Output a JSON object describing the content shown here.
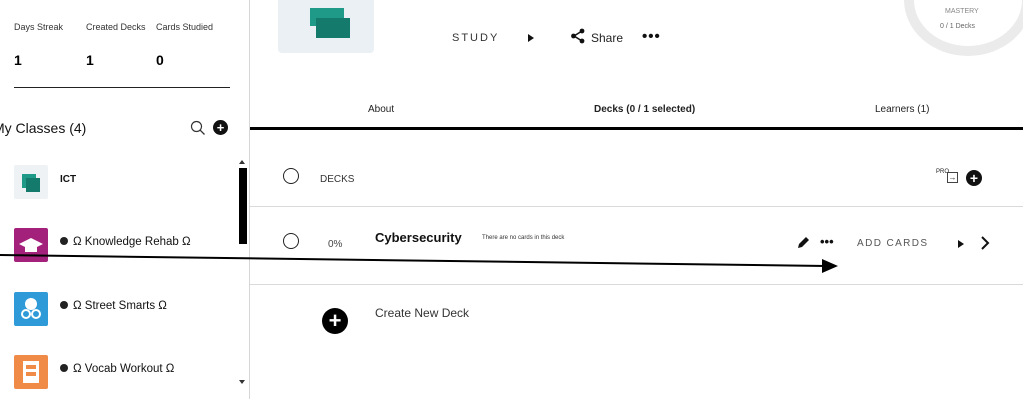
{
  "sidebar": {
    "stats": [
      {
        "label": "Days Streak",
        "value": "1"
      },
      {
        "label": "Created Decks",
        "value": "1"
      },
      {
        "label": "Cards Studied",
        "value": "0"
      }
    ],
    "classes_title": "My Classes (4)",
    "classes": [
      {
        "name": "ICT",
        "thumb_color": "#1f9a89",
        "icon": "stacked-squares-icon"
      },
      {
        "name": "Ω Knowledge Rehab Ω",
        "thumb_color": "#a3217a",
        "icon": "graduation-cap-icon"
      },
      {
        "name": "Ω Street Smarts Ω",
        "thumb_color": "#2e9bd8",
        "icon": "brain-glasses-icon"
      },
      {
        "name": "Ω Vocab Workout Ω",
        "thumb_color": "#f08a47",
        "icon": "dictionary-icon"
      }
    ]
  },
  "header": {
    "study_label": "STUDY",
    "share_label": "Share",
    "mastery_label": "MASTERY",
    "decks_count": "0 / 1 Decks"
  },
  "tabs": [
    {
      "label": "About"
    },
    {
      "label": "Decks (0 / 1 selected)"
    },
    {
      "label": "Learners (1)"
    }
  ],
  "decks": {
    "header_label": "DECKS",
    "pro_label": "PRO",
    "items": [
      {
        "title": "Cybersecurity",
        "percent": "0%",
        "note": "There are no cards in this deck",
        "add_cards_label": "ADD CARDS"
      }
    ],
    "create_label": "Create New Deck"
  },
  "colors": {
    "accent": "#1f9a89",
    "text": "#111111"
  }
}
